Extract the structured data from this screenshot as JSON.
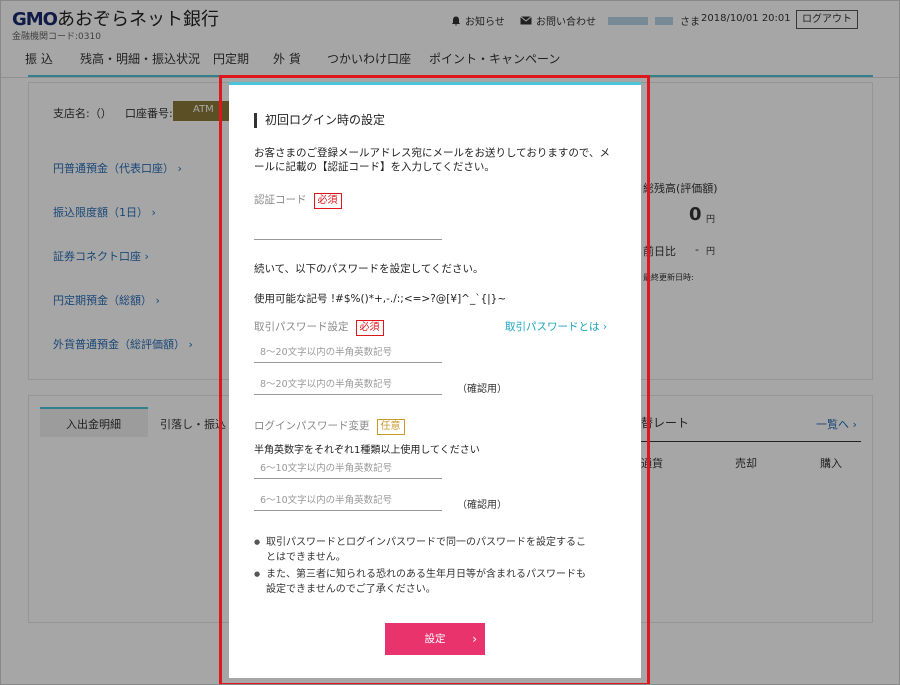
{
  "header": {
    "logo_mark": "GMO",
    "logo_text": "あおぞらネット銀行",
    "bank_code": "金融機関コード:0310",
    "notice": "お知らせ",
    "contact": "お問い合わせ",
    "user_suffix": "さま",
    "datetime": "2018/10/01 20:01",
    "logout": "ログアウト"
  },
  "nav": [
    "振 込",
    "残高・明細・振込状況",
    "円定期",
    "外 貨",
    "つかいわけ口座",
    "ポイント・キャンペーン"
  ],
  "background": {
    "branch_label": "支店名:（）",
    "account_label": "口座番号:",
    "atm_badge": "ATM",
    "links": [
      "円普通預金（代表口座）",
      "振込限度額（1日）",
      "証券コネクト口座",
      "円定期預金（総額）",
      "外貨普通預金（総評価額）"
    ],
    "total_label": "総残高(評価額)",
    "total_value": "0",
    "yen": "円",
    "prev_label": "前日比",
    "prev_value": "-",
    "updated": "最終更新日時:",
    "tab1": "入出金明細",
    "tab2": "引落し・振込",
    "rate_label": "替レート",
    "rate_link": "一覧へ",
    "col_currency": "通貨",
    "col_sell": "売却",
    "col_buy": "購入"
  },
  "modal": {
    "title": "初回ログイン時の設定",
    "desc": "お客さまのご登録メールアドレス宛にメールをお送りしておりますので、メールに記載の【認証コード】を入力してください。",
    "auth_label": "認証コード",
    "required": "必須",
    "optional": "任意",
    "continue_text": "続いて、以下のパスワードを設定してください。",
    "symbols_text": "使用可能な記号 !#$%()*+,-./:;<=>?@[¥]^_`{|}~",
    "trade_pw_label": "取引パスワード設定",
    "trade_pw_help": "取引パスワードとは",
    "trade_pw_placeholder": "8〜20文字以内の半角英数記号",
    "confirm": "（確認用）",
    "login_pw_label": "ログインパスワード変更",
    "login_pw_note": "半角英数字をそれぞれ1種類以上使用してください",
    "login_pw_placeholder": "6〜10文字以内の半角英数記号",
    "notes": [
      "取引パスワードとログインパスワードで同一のパスワードを設定することはできません。",
      "また、第三者に知られる恐れのある生年月日等が含まれるパスワードも設定できませんのでご了承ください。"
    ],
    "submit": "設定"
  },
  "colors": {
    "accent": "#e8336d",
    "highlight": "#e0161d",
    "link": "#1aa3c0",
    "top_border": "#4fc3d8"
  }
}
